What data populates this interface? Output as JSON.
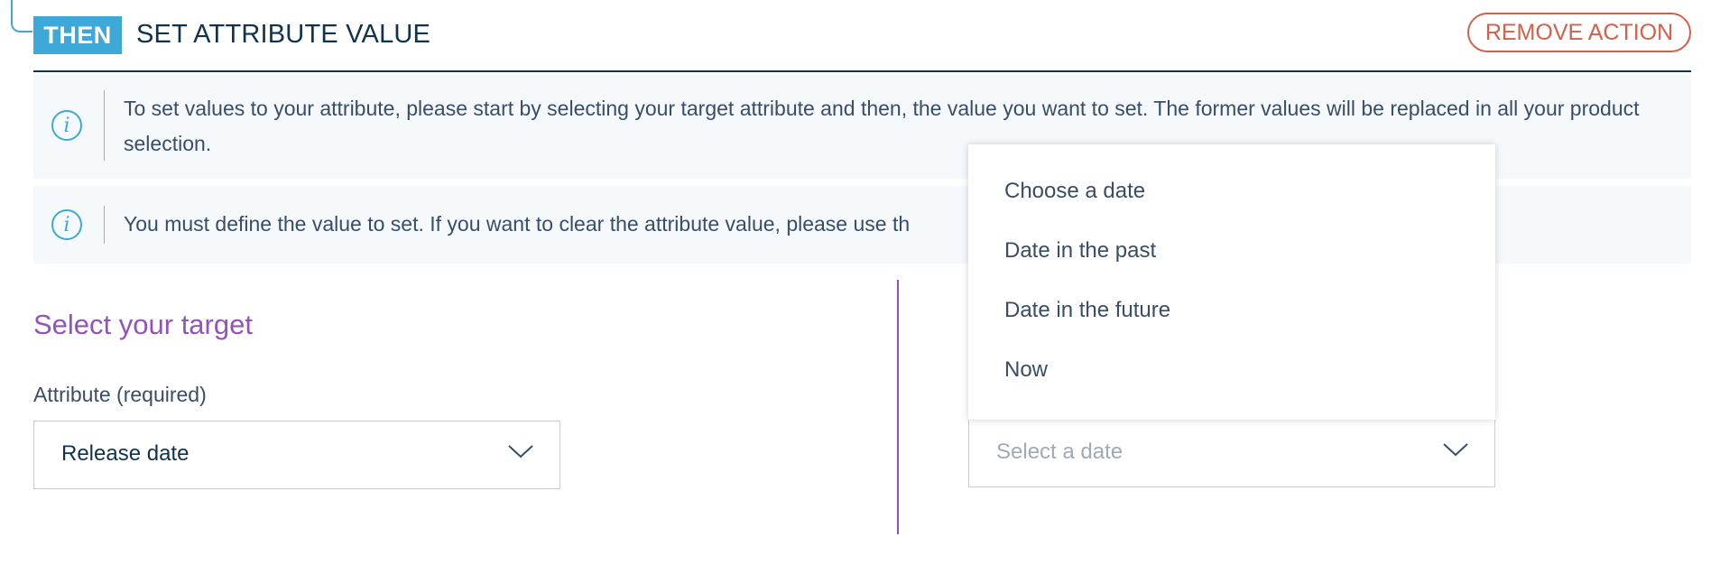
{
  "header": {
    "badge": "THEN",
    "title": "SET ATTRIBUTE VALUE",
    "remove_label": "REMOVE ACTION"
  },
  "info": {
    "message_1": "To set values to your attribute, please start by selecting your target attribute and then, the value you want to set. The former values will be replaced in all your product selection.",
    "message_2": "You must define the value to set. If you want to clear the attribute value, please use th"
  },
  "target": {
    "section_title": "Select your target",
    "attribute_label": "Attribute (required)",
    "attribute_value": "Release date"
  },
  "date_select": {
    "placeholder": "Select a date",
    "options": [
      "Choose a date",
      "Date in the past",
      "Date in the future",
      "Now"
    ]
  },
  "colors": {
    "accent_blue": "#3ea9d8",
    "purple": "#9452ba",
    "danger": "#d4604a",
    "dark_text": "#11324d"
  },
  "icons": {
    "info": "info-icon",
    "chevron": "chevron-down-icon"
  }
}
